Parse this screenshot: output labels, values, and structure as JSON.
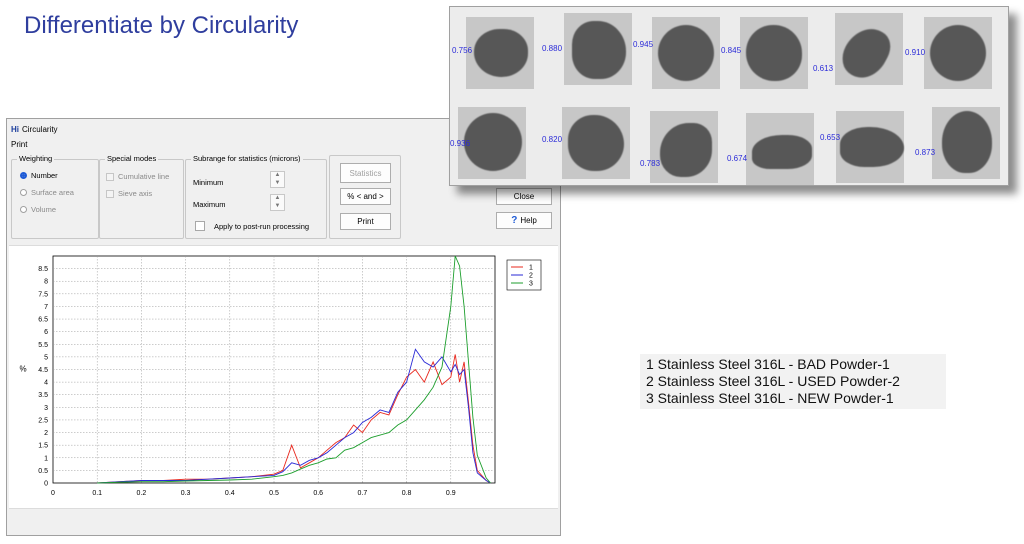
{
  "slide": {
    "title": "Differentiate by Circularity"
  },
  "dialog": {
    "title": "Circularity",
    "app_icon_text": "Hi",
    "menu": [
      "Print"
    ],
    "weighting": {
      "label": "Weighting",
      "options": [
        "Number",
        "Surface area",
        "Volume"
      ],
      "selected": "Number"
    },
    "special_modes": {
      "label": "Special modes",
      "options": [
        "Cumulative line",
        "Sieve axis"
      ]
    },
    "subrange": {
      "label": "Subrange for statistics (microns)",
      "minimum_label": "Minimum",
      "maximum_label": "Maximum",
      "apply_label": "Apply to post-run processing"
    },
    "buttons": {
      "statistics": "Statistics",
      "percent": "% < and >",
      "print": "Print",
      "close": "Close",
      "help": "Help"
    }
  },
  "montage": {
    "row1": [
      "0.756",
      "0.880",
      "0.945",
      "0.845",
      "0.613",
      "0.910"
    ],
    "row2": [
      "0.936",
      "0.820",
      "0.783",
      "0.674",
      "0.653",
      "0.873"
    ]
  },
  "samples": [
    "1  Stainless Steel 316L - BAD Powder-1",
    "2  Stainless Steel 316L - USED Powder-2",
    "3  Stainless Steel 316L - NEW Powder-1"
  ],
  "colors": {
    "series1": "#e8281e",
    "series2": "#2a2ad6",
    "series3": "#1c9e2c",
    "title": "#2f3e9e",
    "values": "#2b2bd8"
  },
  "chart_data": {
    "type": "line",
    "ylabel": "%",
    "xlabel": "",
    "xlim": [
      0,
      1.0
    ],
    "ylim": [
      0,
      9.0
    ],
    "x_ticks": [
      "0",
      "0.1",
      "0.2",
      "0.3",
      "0.4",
      "0.5",
      "0.6",
      "0.7",
      "0.8",
      "0.9"
    ],
    "y_ticks": [
      "0",
      "0.5",
      "1",
      "1.5",
      "2",
      "2.5",
      "3",
      "3.5",
      "4",
      "4.5",
      "5",
      "5.5",
      "6",
      "6.5",
      "7",
      "7.5",
      "8",
      "8.5"
    ],
    "grid": true,
    "legend": "top-right",
    "series": [
      {
        "name": "1",
        "x": [
          0.1,
          0.15,
          0.2,
          0.25,
          0.3,
          0.35,
          0.4,
          0.45,
          0.5,
          0.52,
          0.54,
          0.56,
          0.58,
          0.6,
          0.62,
          0.64,
          0.66,
          0.68,
          0.7,
          0.72,
          0.74,
          0.76,
          0.78,
          0.8,
          0.82,
          0.84,
          0.86,
          0.88,
          0.9,
          0.91,
          0.92,
          0.93,
          0.94,
          0.95,
          0.96,
          0.98,
          0.99
        ],
        "y": [
          0.0,
          0.05,
          0.1,
          0.1,
          0.15,
          0.15,
          0.2,
          0.25,
          0.35,
          0.5,
          1.5,
          0.6,
          0.8,
          1.0,
          1.3,
          1.6,
          1.8,
          2.3,
          2.0,
          2.5,
          2.8,
          2.7,
          3.5,
          4.2,
          4.5,
          4.0,
          4.8,
          3.9,
          4.2,
          5.1,
          4.0,
          4.8,
          3.2,
          1.5,
          0.5,
          0.1,
          0.0
        ]
      },
      {
        "name": "2",
        "x": [
          0.1,
          0.15,
          0.2,
          0.25,
          0.3,
          0.35,
          0.4,
          0.45,
          0.5,
          0.52,
          0.54,
          0.56,
          0.58,
          0.6,
          0.62,
          0.64,
          0.66,
          0.68,
          0.7,
          0.72,
          0.74,
          0.76,
          0.78,
          0.8,
          0.82,
          0.84,
          0.86,
          0.88,
          0.9,
          0.91,
          0.92,
          0.93,
          0.94,
          0.95,
          0.96,
          0.98,
          0.99
        ],
        "y": [
          0.0,
          0.05,
          0.1,
          0.1,
          0.1,
          0.15,
          0.2,
          0.25,
          0.3,
          0.45,
          0.8,
          0.7,
          0.9,
          1.0,
          1.2,
          1.5,
          1.8,
          2.0,
          2.4,
          2.6,
          2.9,
          2.8,
          3.6,
          4.0,
          5.3,
          4.8,
          4.6,
          5.0,
          4.4,
          4.7,
          4.3,
          4.5,
          3.0,
          1.2,
          0.4,
          0.1,
          0.0
        ]
      },
      {
        "name": "3",
        "x": [
          0.1,
          0.15,
          0.2,
          0.25,
          0.3,
          0.35,
          0.4,
          0.45,
          0.5,
          0.52,
          0.54,
          0.56,
          0.58,
          0.6,
          0.62,
          0.64,
          0.66,
          0.68,
          0.7,
          0.72,
          0.74,
          0.76,
          0.78,
          0.8,
          0.82,
          0.84,
          0.86,
          0.88,
          0.89,
          0.9,
          0.91,
          0.92,
          0.93,
          0.94,
          0.95,
          0.96,
          0.98,
          0.99
        ],
        "y": [
          0.0,
          0.03,
          0.05,
          0.05,
          0.08,
          0.1,
          0.12,
          0.15,
          0.25,
          0.3,
          0.4,
          0.55,
          0.7,
          0.8,
          0.95,
          1.0,
          1.3,
          1.4,
          1.6,
          1.8,
          1.9,
          2.0,
          2.3,
          2.5,
          2.9,
          3.3,
          3.8,
          4.6,
          5.8,
          7.0,
          9.0,
          8.6,
          7.0,
          4.8,
          2.6,
          1.1,
          0.2,
          0.0
        ]
      }
    ]
  }
}
